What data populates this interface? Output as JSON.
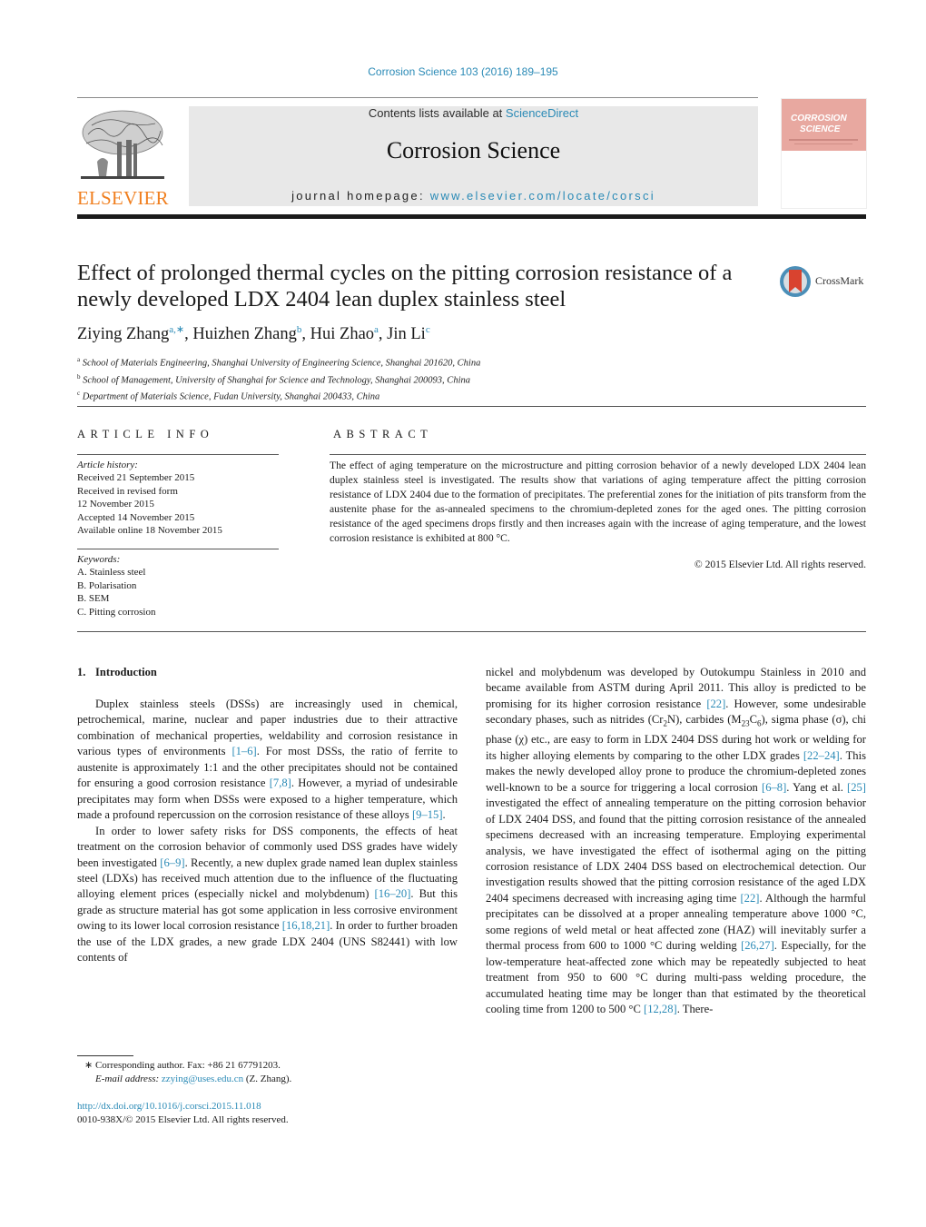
{
  "header": {
    "journal_ref": "Corrosion Science 103 (2016) 189–195",
    "contents_prefix": "Contents lists available at ",
    "contents_link": "ScienceDirect",
    "journal_title": "Corrosion Science",
    "homepage_prefix": "journal homepage: ",
    "homepage_link": "www.elsevier.com/locate/corsci",
    "publisher_logo": "ELSEVIER",
    "cover_title_line1": "CORROSION",
    "cover_title_line2": "SCIENCE",
    "colors": {
      "link": "#2a8ab6",
      "publisher_orange": "#f07f1f",
      "band": "#e8e8e8",
      "cover_pink": "#e8a8a0"
    }
  },
  "article": {
    "title": "Effect of prolonged thermal cycles on the pitting corrosion resistance of a newly developed LDX 2404 lean duplex stainless steel",
    "crossmark_label": "CrossMark",
    "authors": [
      {
        "name": "Ziying Zhang",
        "sup": "a,∗"
      },
      {
        "name": "Huizhen Zhang",
        "sup": "b"
      },
      {
        "name": "Hui Zhao",
        "sup": "a"
      },
      {
        "name": "Jin Li",
        "sup": "c"
      }
    ],
    "affiliations": [
      {
        "mark": "a",
        "text": "School of Materials Engineering, Shanghai University of Engineering Science, Shanghai 201620, China"
      },
      {
        "mark": "b",
        "text": "School of Management, University of Shanghai for Science and Technology, Shanghai 200093, China"
      },
      {
        "mark": "c",
        "text": "Department of Materials Science, Fudan University, Shanghai 200433, China"
      }
    ]
  },
  "article_info": {
    "heading": "ARTICLE INFO",
    "history_label": "Article history:",
    "history": [
      "Received 21 September 2015",
      "Received in revised form",
      "12 November 2015",
      "Accepted 14 November 2015",
      "Available online 18 November 2015"
    ],
    "keywords_label": "Keywords:",
    "keywords": [
      "A. Stainless steel",
      "B. Polarisation",
      "B. SEM",
      "C. Pitting corrosion"
    ]
  },
  "abstract": {
    "heading": "ABSTRACT",
    "text": "The effect of aging temperature on the microstructure and pitting corrosion behavior of a newly developed LDX 2404 lean duplex stainless steel is investigated. The results show that variations of aging temperature affect the pitting corrosion resistance of LDX 2404 due to the formation of precipitates. The preferential zones for the initiation of pits transform from the austenite phase for the as-annealed specimens to the chromium-depleted zones for the aged ones. The pitting corrosion resistance of the aged specimens drops firstly and then increases again with the increase of aging temperature, and the lowest corrosion resistance is exhibited at 800 °C.",
    "copyright": "© 2015 Elsevier Ltd. All rights reserved."
  },
  "body": {
    "section_number": "1.",
    "section_title": "Introduction",
    "p1": [
      {
        "t": "Duplex stainless steels (DSSs) are increasingly used in chemical, petrochemical, marine, nuclear and paper industries due to their attractive combination of mechanical properties, weldability and corrosion resistance in various types of environments "
      },
      {
        "ref": "[1–6]"
      },
      {
        "t": ". For most DSSs, the ratio of ferrite to austenite is approximately 1:1 and the other precipitates should not be contained for ensuring a good corrosion resistance "
      },
      {
        "ref": "[7,8]"
      },
      {
        "t": ". However, a myriad of undesirable precipitates may form when DSSs were exposed to a higher temperature, which made a profound repercussion on the corrosion resistance of these alloys "
      },
      {
        "ref": "[9–15]"
      },
      {
        "t": "."
      }
    ],
    "p2": [
      {
        "t": "In order to lower safety risks for DSS components, the effects of heat treatment on the corrosion behavior of commonly used DSS grades have widely been investigated "
      },
      {
        "ref": "[6–9]"
      },
      {
        "t": ". Recently, a new duplex grade named lean duplex stainless steel (LDXs) has received much attention due to the influence of the fluctuating alloying element prices (especially nickel and molybdenum) "
      },
      {
        "ref": "[16–20]"
      },
      {
        "t": ". But this grade as structure material has got some application in less corrosive environment owing to its lower local corrosion resistance "
      },
      {
        "ref": "[16,18,21]"
      },
      {
        "t": ". In order to further broaden the use of the LDX grades, a new grade LDX 2404 (UNS S82441) with low contents of "
      }
    ],
    "p3": [
      {
        "t": "nickel and molybdenum was developed by Outokumpu Stainless in 2010 and became available from ASTM during April 2011. This alloy is predicted to be promising for its higher corrosion resistance "
      },
      {
        "ref": "[22]"
      },
      {
        "t": ". However, some undesirable secondary phases, such as nitrides (Cr"
      },
      {
        "sub": "2"
      },
      {
        "t": "N), carbides (M"
      },
      {
        "sub": "23"
      },
      {
        "t": "C"
      },
      {
        "sub": "6"
      },
      {
        "t": "), sigma phase (σ), chi phase (χ) etc., are easy to form in LDX 2404 DSS during hot work or welding for its higher alloying elements by comparing to the other LDX grades "
      },
      {
        "ref": "[22–24]"
      },
      {
        "t": ". This makes the newly developed alloy prone to produce the chromium-depleted zones well-known to be a source for triggering a local corrosion "
      },
      {
        "ref": "[6–8]"
      },
      {
        "t": ". Yang et al. "
      },
      {
        "ref": "[25]"
      },
      {
        "t": " investigated the effect of annealing temperature on the pitting corrosion behavior of LDX 2404 DSS, and found that the pitting corrosion resistance of the annealed specimens decreased with an increasing temperature. Employing experimental analysis, we have investigated the effect of isothermal aging on the pitting corrosion resistance of LDX 2404 DSS based on electrochemical detection. Our investigation results showed that the pitting corrosion resistance of the aged LDX 2404 specimens decreased with increasing aging time "
      },
      {
        "ref": "[22]"
      },
      {
        "t": ". Although the harmful precipitates can be dissolved at a proper annealing temperature above 1000 °C, some regions of weld metal or heat affected zone (HAZ) will inevitably surfer a thermal process from 600 to 1000 °C during welding "
      },
      {
        "ref": "[26,27]"
      },
      {
        "t": ". Especially, for the low-temperature heat-affected zone which may be repeatedly subjected to heat treatment from 950 to 600 °C during multi-pass welding procedure, the accumulated heating time may be longer than that estimated by the theoretical cooling time from 1200 to 500 °C "
      },
      {
        "ref": "[12,28]"
      },
      {
        "t": ". There-"
      }
    ]
  },
  "footnotes": {
    "corresponding": "∗  Corresponding author. Fax: +86 21 67791203.",
    "email_label": "E-mail address: ",
    "email": "zzying@uses.edu.cn",
    "email_suffix": " (Z. Zhang).",
    "doi": "http://dx.doi.org/10.1016/j.corsci.2015.11.018",
    "issn": "0010-938X/© 2015 Elsevier Ltd. All rights reserved."
  }
}
